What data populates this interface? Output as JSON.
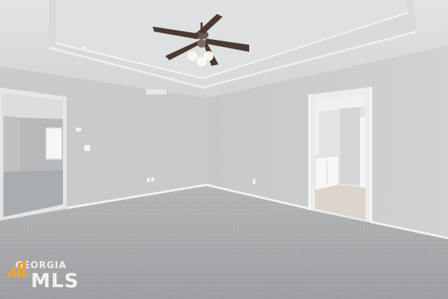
{
  "photo": {
    "subject": "empty-bedroom-with-ceiling-fan",
    "colors": {
      "wall": "#c9cbcc",
      "ceiling": "#d8dada",
      "carpet": "#a9acae",
      "trim": "#f2f2f2",
      "fan_blade": "#4a3a33"
    }
  },
  "watermark": {
    "line1": "GEORGIA",
    "line2": "MLS",
    "logo_color": "#e8a53a"
  }
}
